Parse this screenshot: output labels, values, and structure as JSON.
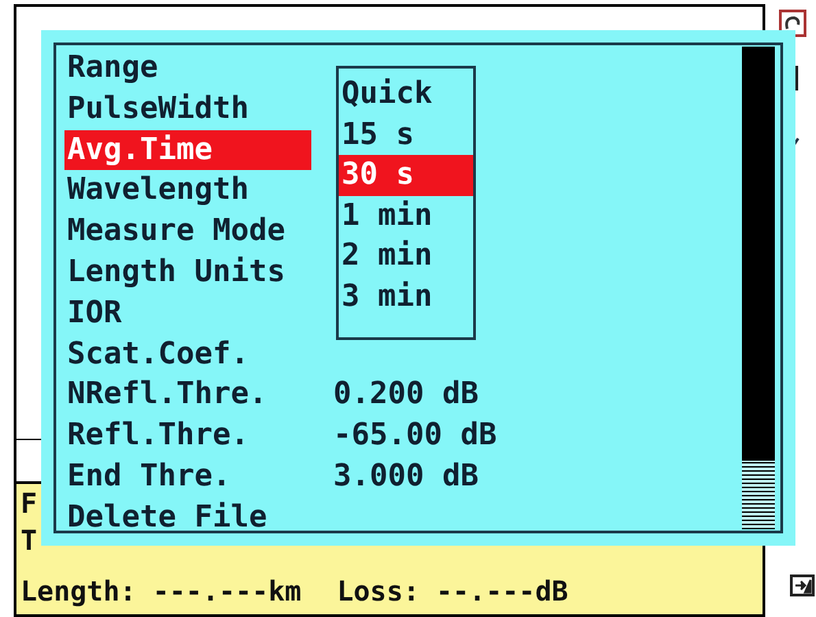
{
  "menu": {
    "items": [
      {
        "label": "Range",
        "selected": false
      },
      {
        "label": "PulseWidth",
        "selected": false
      },
      {
        "label": "Avg.Time",
        "selected": true
      },
      {
        "label": "Wavelength",
        "selected": false
      },
      {
        "label": "Measure Mode",
        "selected": false
      },
      {
        "label": "Length Units",
        "selected": false
      },
      {
        "label": "IOR",
        "selected": false
      },
      {
        "label": "Scat.Coef.",
        "selected": false
      },
      {
        "label": "NRefl.Thre.",
        "value": "0.200 dB",
        "selected": false
      },
      {
        "label": "Refl.Thre.",
        "value": "-65.00 dB",
        "selected": false
      },
      {
        "label": "End Thre.",
        "value": "3.000 dB",
        "selected": false
      },
      {
        "label": "Delete File",
        "selected": false
      }
    ]
  },
  "dropdown": {
    "options": [
      {
        "label": "Quick",
        "selected": false
      },
      {
        "label": "15 s",
        "selected": false
      },
      {
        "label": "30 s",
        "selected": true
      },
      {
        "label": "1 min",
        "selected": false
      },
      {
        "label": "2 min",
        "selected": false
      },
      {
        "label": "3 min",
        "selected": false
      }
    ]
  },
  "background": {
    "lines": [
      "F",
      "T"
    ]
  },
  "status_bar": {
    "length": "Length: ---.---km",
    "loss": "Loss: --.---dB"
  }
}
